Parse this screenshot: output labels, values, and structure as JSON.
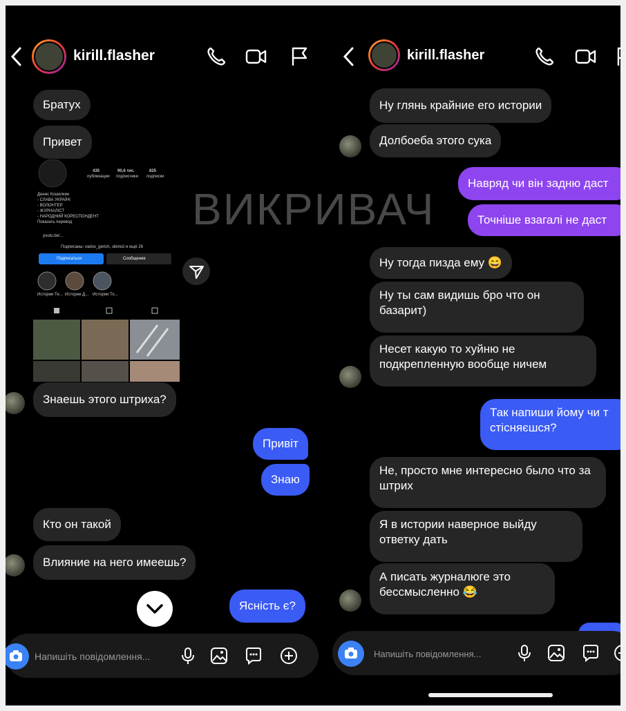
{
  "header": {
    "username": "kirill.flasher",
    "icons": [
      "back-chevron-icon",
      "phone-icon",
      "video-icon",
      "flag-icon"
    ]
  },
  "watermark": "ВИКРИВАЧ",
  "left_chat": {
    "messages": [
      {
        "side": "in",
        "text": "Братух"
      },
      {
        "side": "in",
        "text": "Привет"
      },
      {
        "side": "in",
        "text": "Знаешь этого штриха?"
      },
      {
        "side": "out",
        "text": "Привіт"
      },
      {
        "side": "out",
        "text": "Знаю"
      },
      {
        "side": "in",
        "text": "Кто он такой"
      },
      {
        "side": "in",
        "text": "Влияние на него имеешь?"
      },
      {
        "side": "out",
        "text": "Ясність є?"
      }
    ],
    "shared_profile": {
      "stats": [
        "435",
        "90,6 тис.",
        "825"
      ],
      "stat_labels": [
        "публикации",
        "подписчики",
        "подписки"
      ],
      "name": "Денис Кошелкин",
      "bio": [
        "- СЛАВА УКРАЇНІ",
        "- ВОЛОНТЕР",
        "- ЖУРНАЛІСТ",
        "- НАРОДНИЙ КОРЕСПОНДЕНТ"
      ],
      "translate": "Показать перевод",
      "link": "youtu.be/...",
      "followers_line": "Подписаны: vados_gerich, sikirezi и ещё 26",
      "follow_button": "Подписаться",
      "message_button": "Сообщение",
      "highlights": [
        "Истории Те...",
        "Истории Д...",
        "Истории То..."
      ]
    }
  },
  "right_chat": {
    "messages": [
      {
        "side": "in",
        "text": "Ну глянь крайние его истории"
      },
      {
        "side": "in",
        "text": "Долбоеба этого сука"
      },
      {
        "side": "out",
        "text": "Навряд чи він задню даст"
      },
      {
        "side": "out",
        "text": "Точніше взагалі не даст"
      },
      {
        "side": "in",
        "text": "Ну тогда пизда ему 😄"
      },
      {
        "side": "in",
        "text": "Ну ты сам видишь бро что он базарит)"
      },
      {
        "side": "in",
        "text": "Несет какую то хуйню не подкрепленную вообще ничем"
      },
      {
        "side": "out",
        "text": "Так напиши йому чи т стісняєшся?"
      },
      {
        "side": "in",
        "text": "Не, просто мне интересно было что за  штрих"
      },
      {
        "side": "in",
        "text": "Я в истории наверное выйду ответку дать"
      },
      {
        "side": "in",
        "text": "А писать журналюге это бессмысленно 😂"
      }
    ]
  },
  "composer": {
    "placeholder": "Напишіть повідомлення..."
  },
  "colors": {
    "background": "#000000",
    "incoming_bubble": "#262626",
    "outgoing_blue": "#3b5bf5",
    "outgoing_purple": "#8e44ef",
    "camera_button": "#3b82f6"
  }
}
